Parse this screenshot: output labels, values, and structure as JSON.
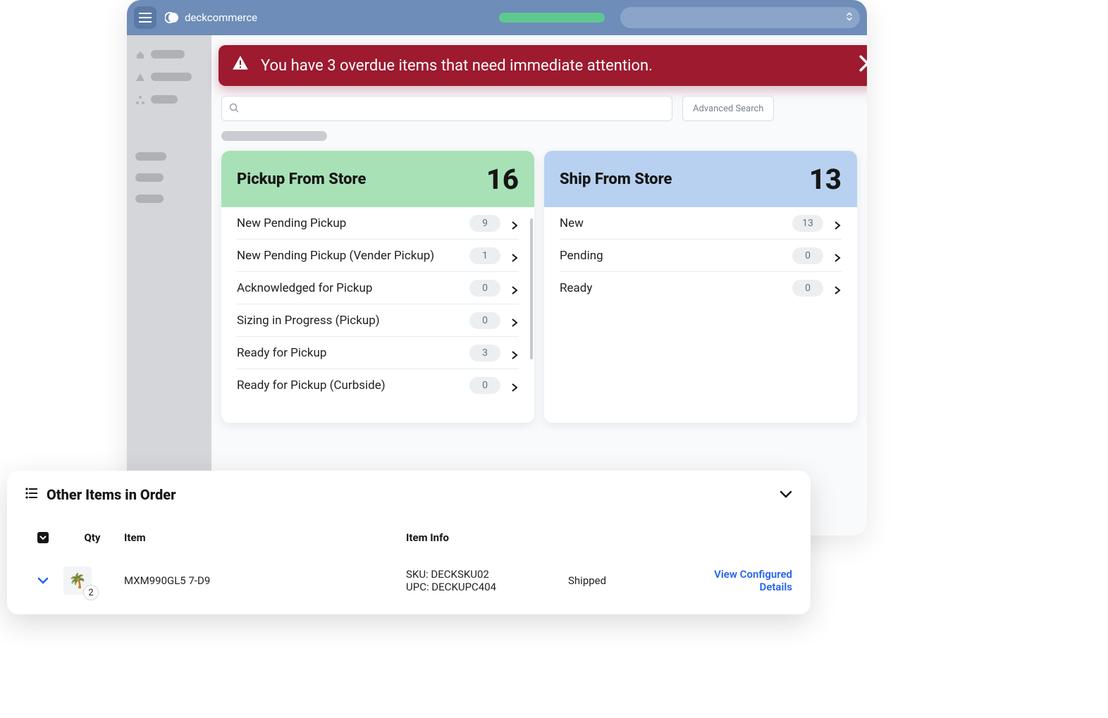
{
  "brand": "deckcommerce",
  "alert": {
    "text": "You have 3 overdue items that need immediate attention."
  },
  "search": {
    "advanced_label": "Advanced Search"
  },
  "cards": {
    "pickup": {
      "title": "Pickup From Store",
      "count": "16",
      "rows": [
        {
          "label": "New Pending Pickup",
          "count": "9"
        },
        {
          "label": "New Pending Pickup (Vender Pickup)",
          "count": "1"
        },
        {
          "label": "Acknowledged for Pickup",
          "count": "0"
        },
        {
          "label": "Sizing in Progress (Pickup)",
          "count": "0"
        },
        {
          "label": "Ready for Pickup",
          "count": "3"
        },
        {
          "label": "Ready for Pickup (Curbside)",
          "count": "0"
        }
      ]
    },
    "ship": {
      "title": "Ship From Store",
      "count": "13",
      "rows": [
        {
          "label": "New",
          "count": "13"
        },
        {
          "label": "Pending",
          "count": "0"
        },
        {
          "label": "Ready",
          "count": "0"
        }
      ]
    }
  },
  "panel": {
    "title": "Other Items in Order",
    "columns": {
      "qty": "Qty",
      "item": "Item",
      "info": "Item Info"
    },
    "row": {
      "qty": "2",
      "item_name": "MXM990GL5 7-D9",
      "sku": "SKU: DECKSKU02",
      "upc": "UPC: DECKUPC404",
      "status": "Shipped",
      "action": "View Configured Details",
      "thumb_emoji": "🌴"
    }
  }
}
